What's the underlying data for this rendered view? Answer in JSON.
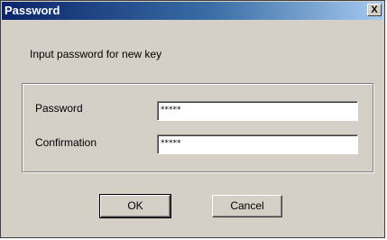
{
  "window": {
    "title": "Password",
    "close_symbol": "X"
  },
  "prompt": "Input password for new key",
  "fields": [
    {
      "label": "Password",
      "value": "*****"
    },
    {
      "label": "Confirmation",
      "value": "*****"
    }
  ],
  "buttons": {
    "ok": "OK",
    "cancel": "Cancel"
  },
  "colors": {
    "dialog_bg": "#d4d0c8",
    "title_start": "#0a246a",
    "title_end": "#a6caf0"
  }
}
